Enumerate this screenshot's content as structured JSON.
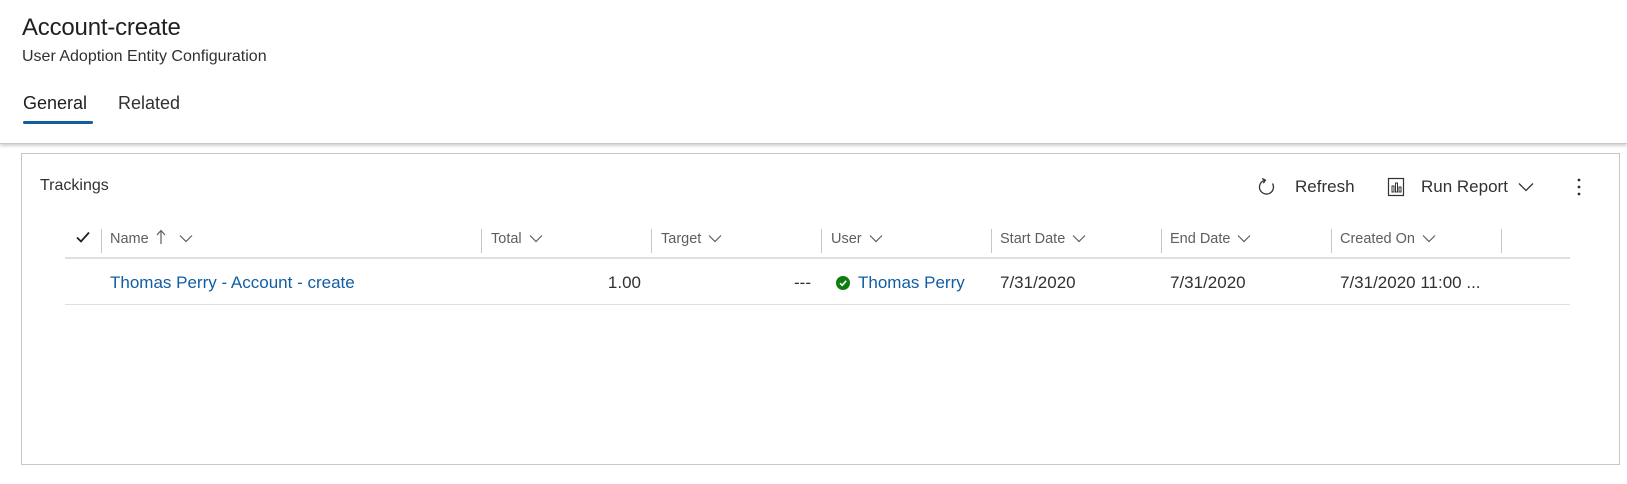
{
  "header": {
    "title": "Account-create",
    "subtitle": "User Adoption Entity Configuration",
    "tabs": [
      {
        "label": "General",
        "selected": true
      },
      {
        "label": "Related",
        "selected": false
      }
    ]
  },
  "panel": {
    "title": "Trackings",
    "commands": {
      "refresh": "Refresh",
      "run_report": "Run Report"
    },
    "columns": [
      {
        "label": "Name",
        "sort": "ascending"
      },
      {
        "label": "Total"
      },
      {
        "label": "Target"
      },
      {
        "label": "User"
      },
      {
        "label": "Start Date"
      },
      {
        "label": "End Date"
      },
      {
        "label": "Created On"
      }
    ],
    "rows": [
      {
        "name": "Thomas Perry - Account - create",
        "total": "1.00",
        "target": "---",
        "user": "Thomas Perry",
        "user_status": "active",
        "start_date": "7/31/2020",
        "end_date": "7/31/2020",
        "created_on": "7/31/2020 11:00 ..."
      }
    ]
  },
  "colors": {
    "accent": "#115ea3",
    "status_green": "#107c10",
    "border": "#c8c6c4"
  },
  "icons": [
    "refresh-icon",
    "report-icon",
    "chevron-down-icon",
    "more-vertical-icon",
    "sort-ascending-icon",
    "checkmark-icon",
    "status-active-icon"
  ]
}
